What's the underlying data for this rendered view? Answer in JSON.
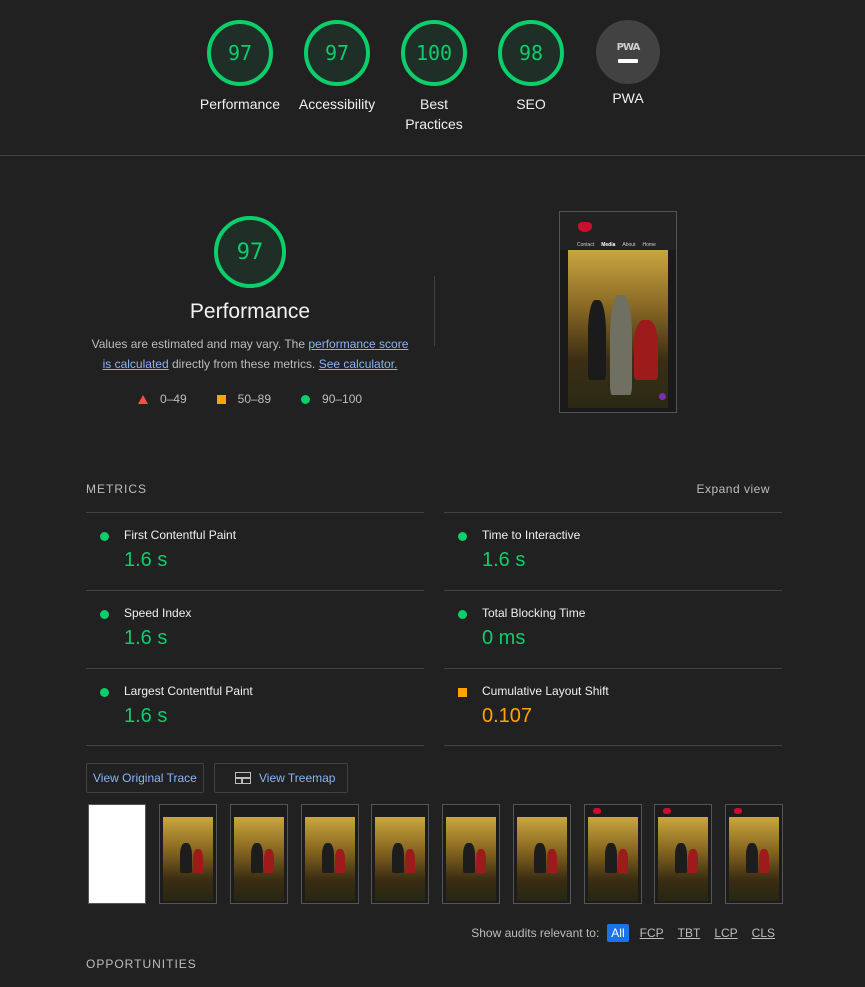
{
  "top_gauges": [
    {
      "score": "97",
      "label": "Performance"
    },
    {
      "score": "97",
      "label": "Accessibility"
    },
    {
      "score": "100",
      "label_line1": "Best",
      "label_line2": "Practices"
    },
    {
      "score": "98",
      "label": "SEO"
    },
    {
      "badge_text": "PWA",
      "label": "PWA"
    }
  ],
  "performance": {
    "score": "97",
    "title": "Performance",
    "desc_pre": "Values are estimated and may vary. The ",
    "link_score": "performance score is calculated",
    "desc_mid": " directly from these metrics. ",
    "link_calc": "See calculator.",
    "legend": [
      "0–49",
      "50–89",
      "90–100"
    ]
  },
  "preview": {
    "nav_links": [
      "Contact",
      "Media",
      "About",
      "Home"
    ]
  },
  "metrics": {
    "heading": "METRICS",
    "expand_label": "Expand view",
    "items": [
      {
        "name": "First Contentful Paint",
        "value": "1.6 s"
      },
      {
        "name": "Time to Interactive",
        "value": "1.6 s"
      },
      {
        "name": "Speed Index",
        "value": "1.6 s"
      },
      {
        "name": "Total Blocking Time",
        "value": "0 ms"
      },
      {
        "name": "Largest Contentful Paint",
        "value": "1.6 s"
      },
      {
        "name": "Cumulative Layout Shift",
        "value": "0.107"
      }
    ]
  },
  "buttons": {
    "trace": "View Original Trace",
    "treemap": "View Treemap"
  },
  "filter": {
    "label": "Show audits relevant to:",
    "chips": [
      "All",
      "FCP",
      "TBT",
      "LCP",
      "CLS"
    ]
  },
  "opportunities_heading": "OPPORTUNITIES",
  "colors": {
    "pass": "#0cce6b",
    "average": "#ffa400",
    "fail": "#ff4e42",
    "link": "#8ab4f8"
  }
}
